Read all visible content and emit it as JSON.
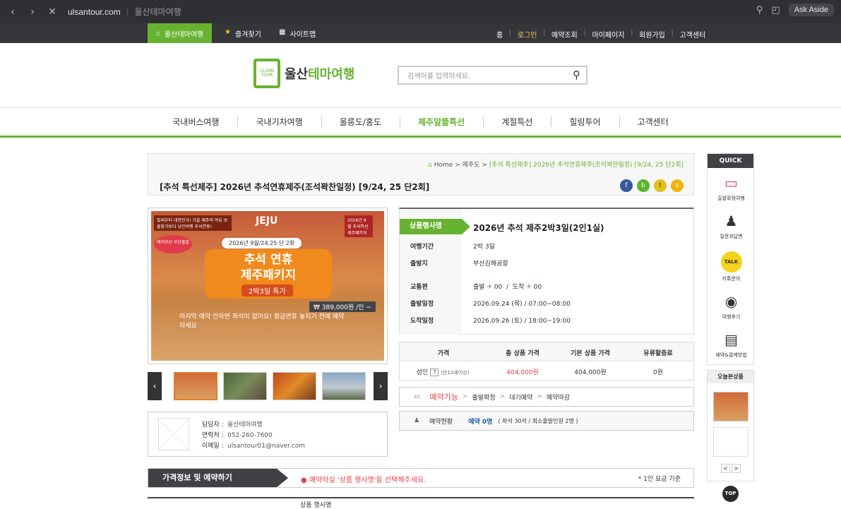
{
  "browser": {
    "url": "ulsantour.com",
    "site_title": "울산테마여행",
    "ask_aside": "Ask Aside"
  },
  "topbar": {
    "home_label": "울산테마여행",
    "favorites_label": "즐겨찾기",
    "sitemap_label": "사이트맵",
    "links": [
      "홈",
      "로그인",
      "예약조회",
      "마이페이지",
      "회원가입",
      "고객센터"
    ]
  },
  "header": {
    "logo_tour": "ULSAN TOUR",
    "logo_main": "울산",
    "logo_accent": "테마여행",
    "search_placeholder": "검색어를 입력하세요."
  },
  "gnb": {
    "items": [
      "국내버스여행",
      "국내기차여행",
      "울릉도/홍도",
      "제주알뜰특선",
      "계절특선",
      "힐링투어",
      "고객센터"
    ],
    "active_index": 3,
    "accent_color": "#67b331"
  },
  "breadcrumb": {
    "home": "Home",
    "level1": "제주도",
    "current": "[추석 특선제주] 2026년 추석연휴제주(조석꽉찬일정) [9/24, 25 단2회]"
  },
  "page_title": "[추석 특선제주] 2026년 추석연휴제주(조석꽉찬일정) [9/24, 25 단2회]",
  "poster": {
    "top_left_tag": "벌써부터 대한민국! 가을 제주의 여유 보물찾기보다 낭만여행 추석연휴!",
    "jeju_text": "JEJU",
    "badge": "2026년 9월 추석특선 제주패키지",
    "circle": "에어부산 부산출발",
    "date_line": "2026년 9월/24,25 단 2회",
    "headline1": "추석 연휴",
    "headline2": "제주패키지",
    "sub": "2박3일 특가",
    "price": "₩ 389,000원 /인 ~",
    "handwriting": "마지막 예약 안하면 좌석이 없어요! 황금연휴 놓치기 전에 예약하세요"
  },
  "contact": {
    "manager_label": "담당자 :",
    "manager": "울산테마여행",
    "phone_label": "연락처 :",
    "phone": "052-260-7600",
    "email_label": "이메일 :",
    "email": "ulsantour01@naver.com"
  },
  "product": {
    "name_tag": "상품행사명",
    "name": "2026년 추석 제주2박3일(2인1실)",
    "period_label": "여행기간",
    "period": "2박 3일",
    "depart_from_label": "출발지",
    "depart_from": "부산김해공항",
    "transport_label": "교통편",
    "transport_depart": "출발",
    "transport_depart_time": "00",
    "transport_arrive": "도착",
    "transport_arrive_time": "00",
    "depart_date_label": "출발일정",
    "depart_date": "2026.09.24 (목) / 07:00~08:00",
    "arrive_date_label": "도착일정",
    "arrive_date": "2026.09.26 (토) / 18:00~19:00"
  },
  "price_table": {
    "headers": [
      "가격",
      "총 상품 가격",
      "기본 상품 가격",
      "유류할증료"
    ],
    "row_label": "성인",
    "row_note": "(만12세이상)",
    "total": "404,000원",
    "base": "404,000원",
    "fuel": "0원"
  },
  "status": {
    "items": [
      "예약가능",
      "출발확정",
      "대기예약",
      "예약마감"
    ]
  },
  "reservation": {
    "label": "예약현황",
    "count": "예약 0명",
    "detail": "( 좌석 30석 / 최소출발인원 2명 )"
  },
  "price_info": {
    "title": "가격정보 및 예약하기",
    "notice": "● 예약하실 '상품 행사명'을 선택해주세요.",
    "base": "* 1인 요금 기준"
  },
  "table_header": {
    "col1": "상품 행사명"
  },
  "quick": {
    "title": "QUICK",
    "items": [
      "출발확정여행",
      "질문과답변",
      "카톡문의",
      "여행후기",
      "예약&결제방법"
    ]
  },
  "today": {
    "title": "오늘본상품",
    "prev": "<",
    "next": ">"
  },
  "top_button": "TOP"
}
